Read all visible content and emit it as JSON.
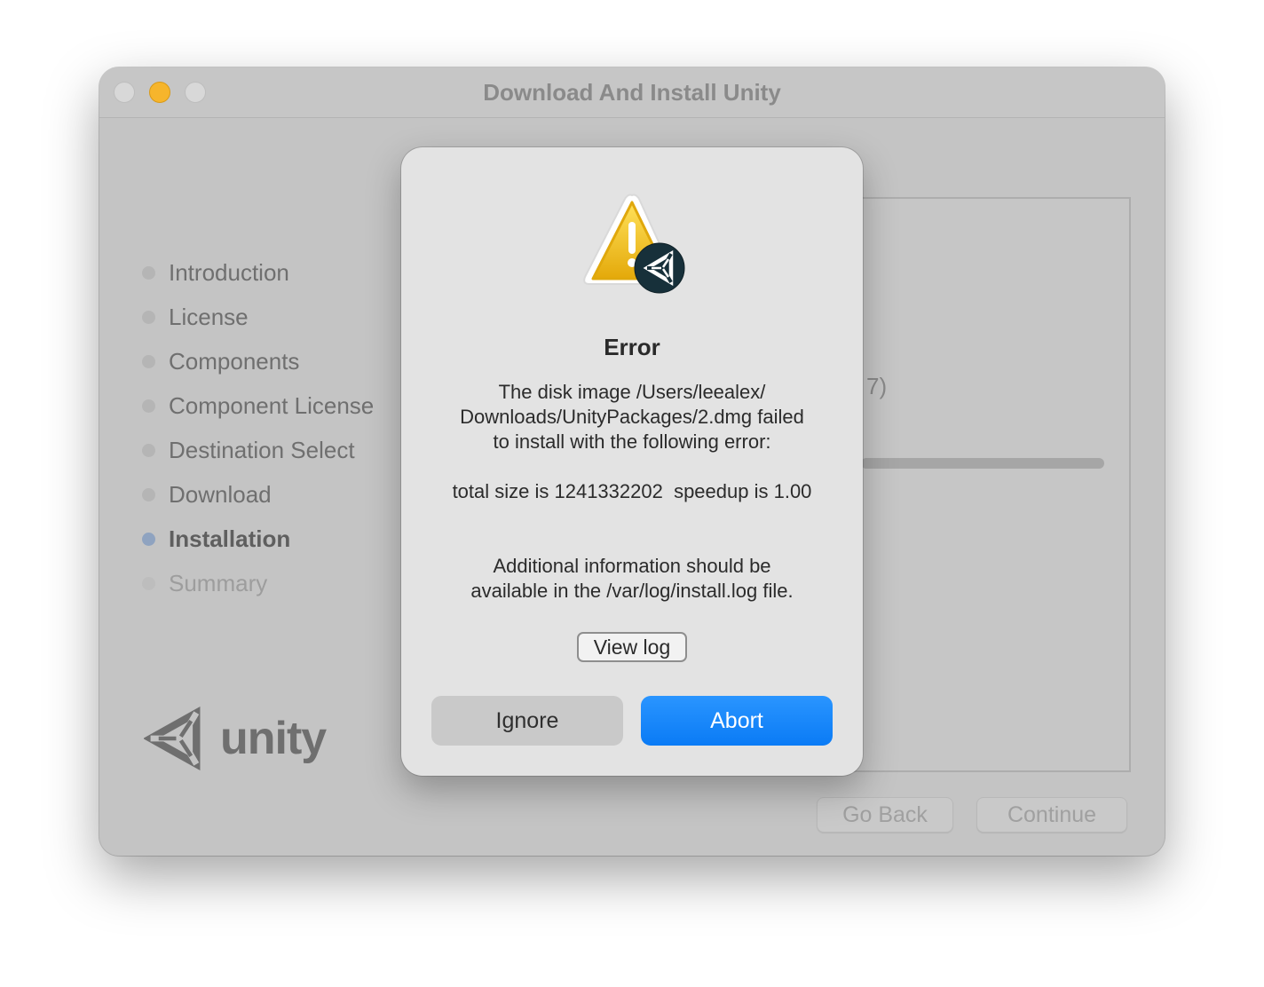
{
  "window": {
    "title": "Download And Install Unity"
  },
  "sidebar": {
    "steps": [
      {
        "label": "Introduction",
        "state": "done"
      },
      {
        "label": "License",
        "state": "done"
      },
      {
        "label": "Components",
        "state": "done"
      },
      {
        "label": "Component License",
        "state": "done"
      },
      {
        "label": "Destination Select",
        "state": "done"
      },
      {
        "label": "Download",
        "state": "done"
      },
      {
        "label": "Installation",
        "state": "active"
      },
      {
        "label": "Summary",
        "state": "future"
      }
    ]
  },
  "logo": {
    "text": "unity",
    "icon": "unity-logo-icon"
  },
  "content": {
    "fragment": "7)"
  },
  "footer": {
    "go_back_label": "Go Back",
    "continue_label": "Continue"
  },
  "alert": {
    "icon": "warning-triangle-icon",
    "badge_icon": "unity-badge-icon",
    "title": "Error",
    "message_line1": "The disk image /Users/leealex/",
    "message_line2": "Downloads/UnityPackages/2.dmg failed",
    "message_line3": "to install with the following error:",
    "size_line": "total size is 1241332202  speedup is 1.00",
    "info_line1": "Additional information should be",
    "info_line2": "available in the /var/log/install.log file.",
    "view_log_label": "View log",
    "ignore_label": "Ignore",
    "abort_label": "Abort"
  },
  "colors": {
    "accent_blue": "#0a7bf5",
    "warning_yellow": "#f2c00c",
    "badge_dark": "#17303a"
  }
}
